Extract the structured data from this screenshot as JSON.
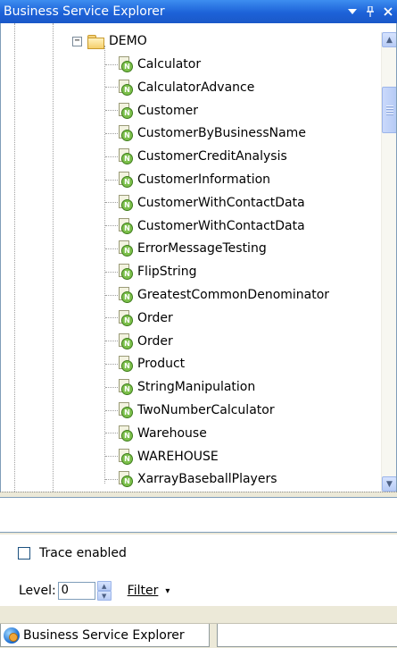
{
  "window": {
    "title": "Business Service Explorer",
    "dropdown_icon": "dropdown-arrow",
    "pin_icon": "pin",
    "close_icon": "close"
  },
  "tree": {
    "folder": {
      "label": "DEMO",
      "expander": "−",
      "expanded": true
    },
    "items": [
      {
        "label": "Calculator"
      },
      {
        "label": "CalculatorAdvance"
      },
      {
        "label": "Customer"
      },
      {
        "label": "CustomerByBusinessName"
      },
      {
        "label": "CustomerCreditAnalysis"
      },
      {
        "label": "CustomerInformation"
      },
      {
        "label": "CustomerWithContactData"
      },
      {
        "label": "CustomerWithContactData"
      },
      {
        "label": "ErrorMessageTesting"
      },
      {
        "label": "FlipString"
      },
      {
        "label": "GreatestCommonDenominator"
      },
      {
        "label": "Order"
      },
      {
        "label": "Order"
      },
      {
        "label": "Product"
      },
      {
        "label": "StringManipulation"
      },
      {
        "label": "TwoNumberCalculator"
      },
      {
        "label": "Warehouse"
      },
      {
        "label": "WAREHOUSE"
      },
      {
        "label": "XarrayBaseballPlayers"
      }
    ],
    "item_badge": "N"
  },
  "trace": {
    "checkbox_label": "Trace enabled",
    "checked": false,
    "level_label": "Level:",
    "level_value": "0",
    "filter_label": "Filter",
    "filter_arrow": "▾"
  },
  "tabs": {
    "active_label": "Business Service Explorer"
  },
  "colors": {
    "titlebar": "#2868d8",
    "badge": "#7cc04b",
    "border": "#7f9db9"
  }
}
